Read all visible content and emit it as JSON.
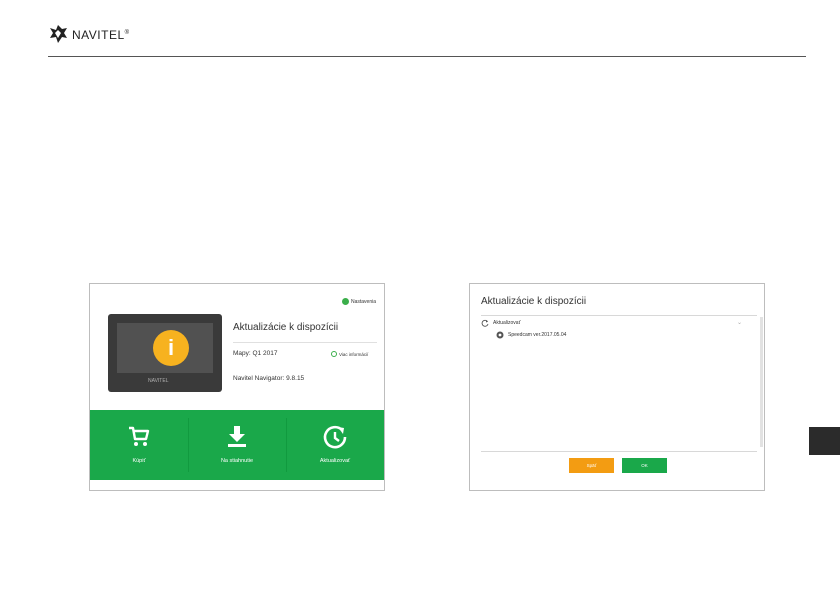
{
  "header": {
    "brand_name": "NAVITEL",
    "brand_mark": "®",
    "logo_icon": "navitel-logo-icon"
  },
  "lang_tab": {
    "label": ""
  },
  "left_screen": {
    "settings_label": "Nastavenia",
    "title": "Aktualizácie k dispozícii",
    "maps_text": "Mapy: Q1 2017",
    "more_info_label": "Viac informácií",
    "navigator_text": "Navitel Navigator: 9.8.15",
    "device_logo": "NAVITEL",
    "buttons": [
      {
        "label": "Kúpiť",
        "icon": "cart-icon"
      },
      {
        "label": "Na stiahnutie",
        "icon": "download-icon"
      },
      {
        "label": "Aktualizovať",
        "icon": "update-icon"
      }
    ],
    "colors": {
      "green": "#1aa84a",
      "info": "#f7b21f"
    }
  },
  "right_screen": {
    "title": "Aktualizácie k dispozícii",
    "update_label": "Aktualizovať",
    "item_label": "Speedcam ver.2017.05.04",
    "back_label": "Späť",
    "ok_label": "OK",
    "colors": {
      "back": "#f39c12",
      "ok": "#1aa84a"
    }
  }
}
